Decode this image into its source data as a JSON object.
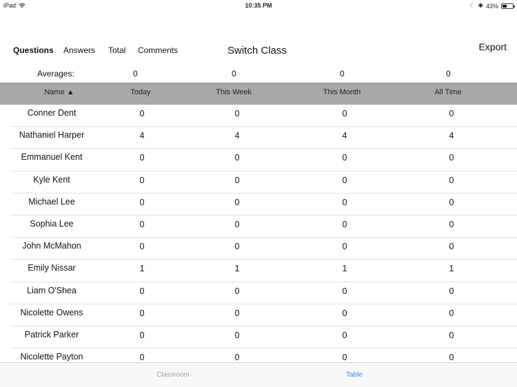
{
  "status_bar": {
    "device": "iPad",
    "time": "10:35 PM",
    "battery_percent": "43%",
    "battery_level": 0.43
  },
  "toolbar": {
    "segments": [
      "Questions",
      "Answers",
      "Total",
      "Comments"
    ],
    "active_segment": "Questions",
    "switch_class": "Switch Class",
    "export": "Export"
  },
  "averages": {
    "label": "Averages:",
    "values": [
      "0",
      "0",
      "0",
      "0"
    ]
  },
  "table": {
    "columns": [
      "Name ▲",
      "Today",
      "This Week",
      "This Month",
      "All Time"
    ],
    "rows": [
      {
        "name": "Conner Dent",
        "today": "0",
        "week": "0",
        "month": "0",
        "all": "0"
      },
      {
        "name": "Nathaniel Harper",
        "today": "4",
        "week": "4",
        "month": "4",
        "all": "4"
      },
      {
        "name": "Emmanuel Kent",
        "today": "0",
        "week": "0",
        "month": "0",
        "all": "0"
      },
      {
        "name": "Kyle Kent",
        "today": "0",
        "week": "0",
        "month": "0",
        "all": "0"
      },
      {
        "name": "Michael Lee",
        "today": "0",
        "week": "0",
        "month": "0",
        "all": "0"
      },
      {
        "name": "Sophia Lee",
        "today": "0",
        "week": "0",
        "month": "0",
        "all": "0"
      },
      {
        "name": "John McMahon",
        "today": "0",
        "week": "0",
        "month": "0",
        "all": "0"
      },
      {
        "name": "Emily Nissar",
        "today": "1",
        "week": "1",
        "month": "1",
        "all": "1"
      },
      {
        "name": "Liam O'Shea",
        "today": "0",
        "week": "0",
        "month": "0",
        "all": "0"
      },
      {
        "name": "Nicolette Owens",
        "today": "0",
        "week": "0",
        "month": "0",
        "all": "0"
      },
      {
        "name": "Patrick Parker",
        "today": "0",
        "week": "0",
        "month": "0",
        "all": "0"
      },
      {
        "name": "Nicolette Payton",
        "today": "0",
        "week": "0",
        "month": "0",
        "all": "0"
      }
    ]
  },
  "tab_bar": {
    "tabs": [
      "Classroom",
      "Table"
    ],
    "active": "Table",
    "active_color": "#3a8ee6",
    "inactive_color": "#a0a0a0"
  }
}
